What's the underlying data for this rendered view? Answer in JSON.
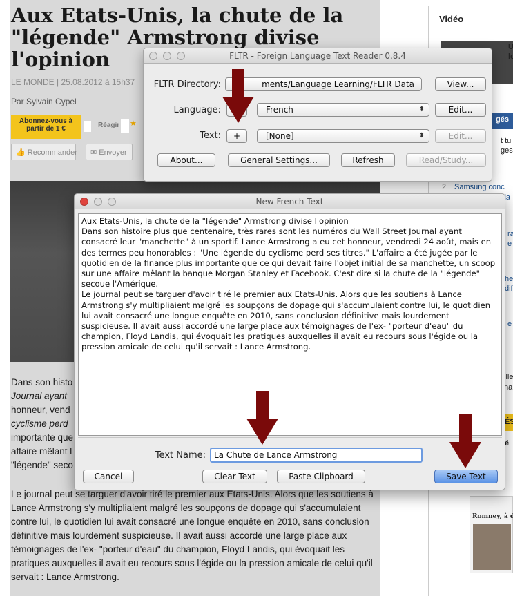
{
  "article": {
    "headline": "Aux Etats-Unis, la chute de la \"légende\" Armstrong divise l'opinion",
    "dateline": "LE MONDE | 25.08.2012 à 15h37",
    "byline": "Par Sylvain Cypel",
    "subscribe": "Abonnez-vous à partir de 1 €",
    "react": "Réagir",
    "share_recommend": "Recommander",
    "share_send": "Envoyer",
    "para1_lines": [
      "Dans son histo",
      "Journal ayant",
      "honneur, vend",
      "cyclisme perd",
      "importante que",
      "affaire mêlant l",
      "\"légende\" seco"
    ],
    "para2": "Le journal peut se targuer d'avoir tiré le premier aux Etats-Unis. Alors que les soutiens à Lance Armstrong s'y multipliaient malgré les soupçons de dopage qui s'accumulaient contre lui, le quotidien lui avait consacré une longue enquête en 2010, sans conclusion définitive mais lourdement suspicieuse. Il avait aussi accordé une large place aux témoignages de l'ex- \"porteur d'eau\" du champion, Floyd Landis, qui évoquait les pratiques auxquelles il avait eu recours sous l'égide ou la pression amicale de celui qu'il servait : Lance Armstrong."
  },
  "sidebar": {
    "video_title": "Vidéo",
    "snippets": [
      "U",
      "lo",
      "gés",
      "t tu",
      "ges",
      "2",
      "Samsung conc",
      "lia",
      "rad",
      "e",
      "he",
      "dif",
      "e",
      "ille",
      "na",
      "ÉS",
      "é",
      "Romney, à dr"
    ]
  },
  "fltr": {
    "title": "FLTR - Foreign Language Text Reader 0.8.4",
    "dir_label": "FLTR Directory:",
    "dir_value": "ments/Language Learning/FLTR Data",
    "view_btn": "View...",
    "lang_label": "Language:",
    "lang_value": "French",
    "edit_lang_btn": "Edit...",
    "text_label": "Text:",
    "add_btn": "+",
    "text_value": "[None]",
    "edit_text_btn": "Edit...",
    "about_btn": "About...",
    "settings_btn": "General Settings...",
    "refresh_btn": "Refresh",
    "read_btn": "Read/Study..."
  },
  "new_text": {
    "title": "New French Text",
    "content": "Aux Etats-Unis, la chute de la \"légende\" Armstrong divise l'opinion\nDans son histoire plus que centenaire, très rares sont les numéros du Wall Street Journal ayant consacré leur \"manchette\" à un sportif. Lance Armstrong a eu cet honneur, vendredi 24 août, mais en des termes peu honorables : \"Une légende du cyclisme perd ses titres.\" L'affaire a été jugée par le quotidien de la finance plus importante que ce qui devait faire l'objet initial de sa manchette, un scoop sur une affaire mêlant la banque Morgan Stanley et Facebook. C'est dire si la chute de la \"légende\" secoue l'Amérique.\nLe journal peut se targuer d'avoir tiré le premier aux Etats-Unis. Alors que les soutiens à Lance Armstrong s'y multipliaient malgré les soupçons de dopage qui s'accumulaient contre lui, le quotidien lui avait consacré une longue enquête en 2010, sans conclusion définitive mais lourdement suspicieuse. Il avait aussi accordé une large place aux témoignages de l'ex- \"porteur d'eau\" du champion, Floyd Landis, qui évoquait les pratiques auxquelles il avait eu recours sous l'égide ou la pression amicale de celui qu'il servait : Lance Armstrong.",
    "name_label": "Text Name:",
    "name_value": "La Chute de Lance Armstrong",
    "cancel_btn": "Cancel",
    "clear_btn": "Clear Text",
    "paste_btn": "Paste Clipboard",
    "save_btn": "Save Text"
  },
  "colors": {
    "arrow": "#7a0a0a",
    "primary_button": "#5b93e6",
    "subscribe": "#f3c41c"
  }
}
